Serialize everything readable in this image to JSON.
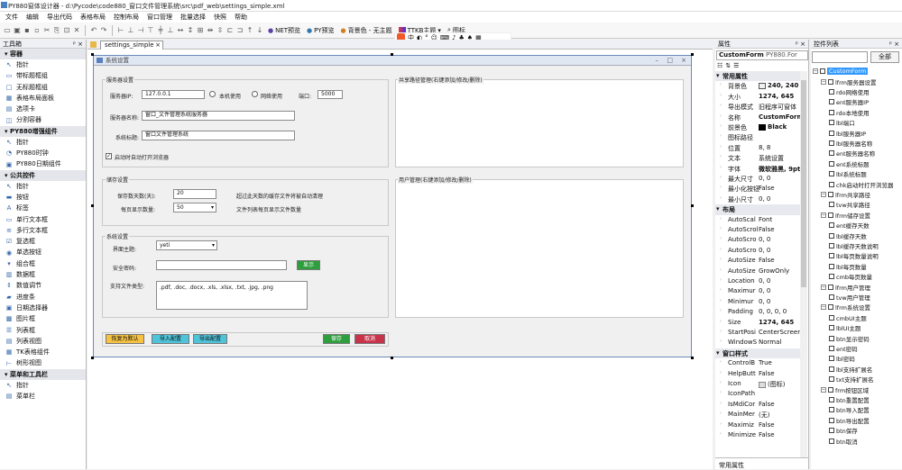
{
  "window": {
    "title": "PY880窗体设计器 - d:\\Pycode\\code880_窗口文件管理系统\\src\\pdf_web\\settings_simple.xml"
  },
  "menu": [
    "文件",
    "编辑",
    "导出代码",
    "表格布局",
    "控制布局",
    "窗口管理",
    "批量选择",
    "快照",
    "帮助"
  ],
  "toolbar": {
    "net_preview": "NET预览",
    "py_preview": "PY预览",
    "bg_color": "背景色 - 无主题",
    "ttkb_theme": "TTKB主题",
    "icon_label": "图标"
  },
  "toolbox": {
    "title": "工具箱",
    "items": [
      {
        "type": "cat",
        "label": "容器"
      },
      {
        "type": "item",
        "icon": "pointer-icon",
        "label": "指针"
      },
      {
        "type": "item",
        "icon": "groupbox-icon",
        "label": "带标题框组"
      },
      {
        "type": "item",
        "icon": "frame-icon",
        "label": "无标题框组"
      },
      {
        "type": "item",
        "icon": "table-icon",
        "label": "表格布局面板"
      },
      {
        "type": "item",
        "icon": "tab-icon",
        "label": "选项卡"
      },
      {
        "type": "item",
        "icon": "split-icon",
        "label": "分割容器"
      },
      {
        "type": "cat",
        "label": "PY880增强组件"
      },
      {
        "type": "item",
        "icon": "pointer-icon",
        "label": "指针"
      },
      {
        "type": "item",
        "icon": "clock-icon",
        "label": "PY880时钟"
      },
      {
        "type": "item",
        "icon": "calendar-icon",
        "label": "PY880日期组件"
      },
      {
        "type": "cat",
        "label": "公共控件"
      },
      {
        "type": "item",
        "icon": "pointer-icon",
        "label": "指针"
      },
      {
        "type": "item",
        "icon": "button-icon",
        "label": "按钮"
      },
      {
        "type": "item",
        "icon": "label-icon",
        "label": "标签"
      },
      {
        "type": "item",
        "icon": "textbox-icon",
        "label": "单行文本框"
      },
      {
        "type": "item",
        "icon": "multiline-icon",
        "label": "多行文本框"
      },
      {
        "type": "item",
        "icon": "checkbox-icon",
        "label": "复选框"
      },
      {
        "type": "item",
        "icon": "radio-icon",
        "label": "单选按钮"
      },
      {
        "type": "item",
        "icon": "combo-icon",
        "label": "组合框"
      },
      {
        "type": "item",
        "icon": "list-icon",
        "label": "数据框"
      },
      {
        "type": "item",
        "icon": "spin-icon",
        "label": "数值调节"
      },
      {
        "type": "item",
        "icon": "progress-icon",
        "label": "进度条"
      },
      {
        "type": "item",
        "icon": "date-icon",
        "label": "日期选择器"
      },
      {
        "type": "item",
        "icon": "picture-icon",
        "label": "图片框"
      },
      {
        "type": "item",
        "icon": "listbox-icon",
        "label": "列表框"
      },
      {
        "type": "item",
        "icon": "listview-icon",
        "label": "列表视图"
      },
      {
        "type": "item",
        "icon": "tk-icon",
        "label": "TK表格组件"
      },
      {
        "type": "item",
        "icon": "tree-icon",
        "label": "树形视图"
      },
      {
        "type": "cat",
        "label": "菜单和工具栏"
      },
      {
        "type": "item",
        "icon": "pointer-icon",
        "label": "指针"
      },
      {
        "type": "item",
        "icon": "menu-icon",
        "label": "菜单栏"
      }
    ]
  },
  "editor": {
    "tab": "settings_simple"
  },
  "form": {
    "title": "系统设置",
    "server_group": "服务器设置",
    "server_ip_label": "服务器IP:",
    "server_ip": "127.0.0.1",
    "radio_local": "本机使用",
    "radio_network": "网络使用",
    "port_label": "端口:",
    "port": "5000",
    "server_name_label": "服务器名称:",
    "server_name": "窗口_文件管理系统服务器",
    "system_title_label": "系统标题:",
    "system_title": "窗口文件管理系统",
    "autostart": "启动时自动打开浏览器",
    "share_group": "共享路径管理(右键添加/修改/删除)",
    "store_group": "储存设置",
    "keep_days_label": "保存数天数(天):",
    "keep_days": "20",
    "keep_days_hint": "超过此天数的缓存文件将被自动清理",
    "page_size_label": "每页显示数量:",
    "page_size": "50",
    "page_size_hint": "文件列表每页显示文件数量",
    "user_group": "用户管理(右键添加/修改/删除)",
    "sys_group": "系统设置",
    "theme_label": "界面主题:",
    "theme": "yeti",
    "pwd_label": "安全密码:",
    "pwd_btn": "显示",
    "ext_label": "支持文件类型:",
    "ext": ".pdf, .doc, .docx, .xls, .xlsx, .txt, .jpg, .png",
    "btn_reset": "恢复为默认",
    "btn_import": "导入配置",
    "btn_export": "导出配置",
    "btn_save": "保存",
    "btn_cancel": "取消"
  },
  "props": {
    "title": "属性",
    "object": "CustomForm",
    "object_type": "PY880.For",
    "rows": [
      {
        "cat": true,
        "k": "常用属性"
      },
      {
        "k": "背景色",
        "v": "240, 240"
      },
      {
        "k": "大小",
        "v": "1274, 645"
      },
      {
        "k": "导出模式",
        "v": "旧程序可窗体"
      },
      {
        "k": "名称",
        "v": "CustomForm"
      },
      {
        "k": "前景色",
        "v": "Black"
      },
      {
        "k": "图标路径",
        "v": ""
      },
      {
        "k": "位置",
        "v": "8, 8"
      },
      {
        "k": "文本",
        "v": "系统设置"
      },
      {
        "k": "字体",
        "v": "微软雅黑, 9pt"
      },
      {
        "k": "最大尺寸",
        "v": "0, 0"
      },
      {
        "k": "最小化按钮",
        "v": "False"
      },
      {
        "k": "最小尺寸",
        "v": "0, 0"
      },
      {
        "cat": true,
        "k": "布局"
      },
      {
        "k": "AutoScal",
        "v": "Font"
      },
      {
        "k": "AutoScrol",
        "v": "False"
      },
      {
        "k": "AutoScro",
        "v": "0, 0"
      },
      {
        "k": "AutoScro",
        "v": "0, 0"
      },
      {
        "k": "AutoSize",
        "v": "False"
      },
      {
        "k": "AutoSize",
        "v": "GrowOnly"
      },
      {
        "k": "Location",
        "v": "0, 0"
      },
      {
        "k": "Maximur",
        "v": "0, 0"
      },
      {
        "k": "Minimur",
        "v": "0, 0"
      },
      {
        "k": "Padding",
        "v": "0, 0, 0, 0"
      },
      {
        "k": "Size",
        "v": "1274, 645"
      },
      {
        "k": "StartPosi",
        "v": "CenterScreen"
      },
      {
        "k": "WindowS",
        "v": "Normal"
      },
      {
        "cat": true,
        "k": "窗口样式"
      },
      {
        "k": "ControlB",
        "v": "True"
      },
      {
        "k": "HelpButt",
        "v": "False"
      },
      {
        "k": "Icon",
        "v": "(图标)"
      },
      {
        "k": "IconPath",
        "v": ""
      },
      {
        "k": "IsMdiCor",
        "v": "False"
      },
      {
        "k": "MainMer",
        "v": "(无)"
      },
      {
        "k": "Maximiz",
        "v": "False"
      },
      {
        "k": "Minimize",
        "v": "False"
      }
    ],
    "footer": "常用属性"
  },
  "ctrl": {
    "title": "控件列表",
    "button": "全部",
    "tree": [
      {
        "lvl": 0,
        "ex": true,
        "label": "CustomForm",
        "sel": true
      },
      {
        "lvl": 1,
        "ex": true,
        "label": "lfrm服务器设置"
      },
      {
        "lvl": 2,
        "label": "rdo网络使用"
      },
      {
        "lvl": 2,
        "label": "ent服务器IP"
      },
      {
        "lvl": 2,
        "label": "rdo本地使用"
      },
      {
        "lvl": 2,
        "label": "lbl端口"
      },
      {
        "lvl": 2,
        "label": "lbl服务器IP"
      },
      {
        "lvl": 2,
        "label": "lbl服务器名称"
      },
      {
        "lvl": 2,
        "label": "ent服务器名称"
      },
      {
        "lvl": 2,
        "label": "ent系统标题"
      },
      {
        "lvl": 2,
        "label": "lbl系统标题"
      },
      {
        "lvl": 2,
        "label": "chk启动时打开浏览器"
      },
      {
        "lvl": 1,
        "ex": true,
        "label": "lfrm共享路径"
      },
      {
        "lvl": 2,
        "label": "tvw共享路径"
      },
      {
        "lvl": 1,
        "ex": true,
        "label": "lfrm储存设置"
      },
      {
        "lvl": 2,
        "label": "ent缓存天数"
      },
      {
        "lvl": 2,
        "label": "lbl缓存天数"
      },
      {
        "lvl": 2,
        "label": "lbl缓存天数说明"
      },
      {
        "lvl": 2,
        "label": "lbl每页数量说明"
      },
      {
        "lvl": 2,
        "label": "lbl每页数量"
      },
      {
        "lvl": 2,
        "label": "cmb每页数量"
      },
      {
        "lvl": 1,
        "ex": true,
        "label": "lfrm用户管理"
      },
      {
        "lvl": 2,
        "label": "tvw用户管理"
      },
      {
        "lvl": 1,
        "ex": true,
        "label": "lfrm系统设置"
      },
      {
        "lvl": 2,
        "label": "cmbUI主题"
      },
      {
        "lvl": 2,
        "label": "lblUI主题"
      },
      {
        "lvl": 2,
        "label": "btn显示密码"
      },
      {
        "lvl": 2,
        "label": "ent密码"
      },
      {
        "lvl": 2,
        "label": "lbl密码"
      },
      {
        "lvl": 2,
        "label": "lbl支持扩展名"
      },
      {
        "lvl": 2,
        "label": "txt支持扩展名"
      },
      {
        "lvl": 1,
        "ex": true,
        "label": "frm按钮区域"
      },
      {
        "lvl": 2,
        "label": "btn重置配置"
      },
      {
        "lvl": 2,
        "label": "btn导入配置"
      },
      {
        "lvl": 2,
        "label": "btn导出配置"
      },
      {
        "lvl": 2,
        "label": "btn保存"
      },
      {
        "lvl": 2,
        "label": "btn取消"
      }
    ]
  },
  "colors": {
    "accent": "#3399ff",
    "reset_btn": "#f5c242",
    "import_btn": "#4fc3d9",
    "export_btn": "#4fc3d9",
    "save_btn": "#2e9e3e",
    "cancel_btn": "#c8334a"
  }
}
